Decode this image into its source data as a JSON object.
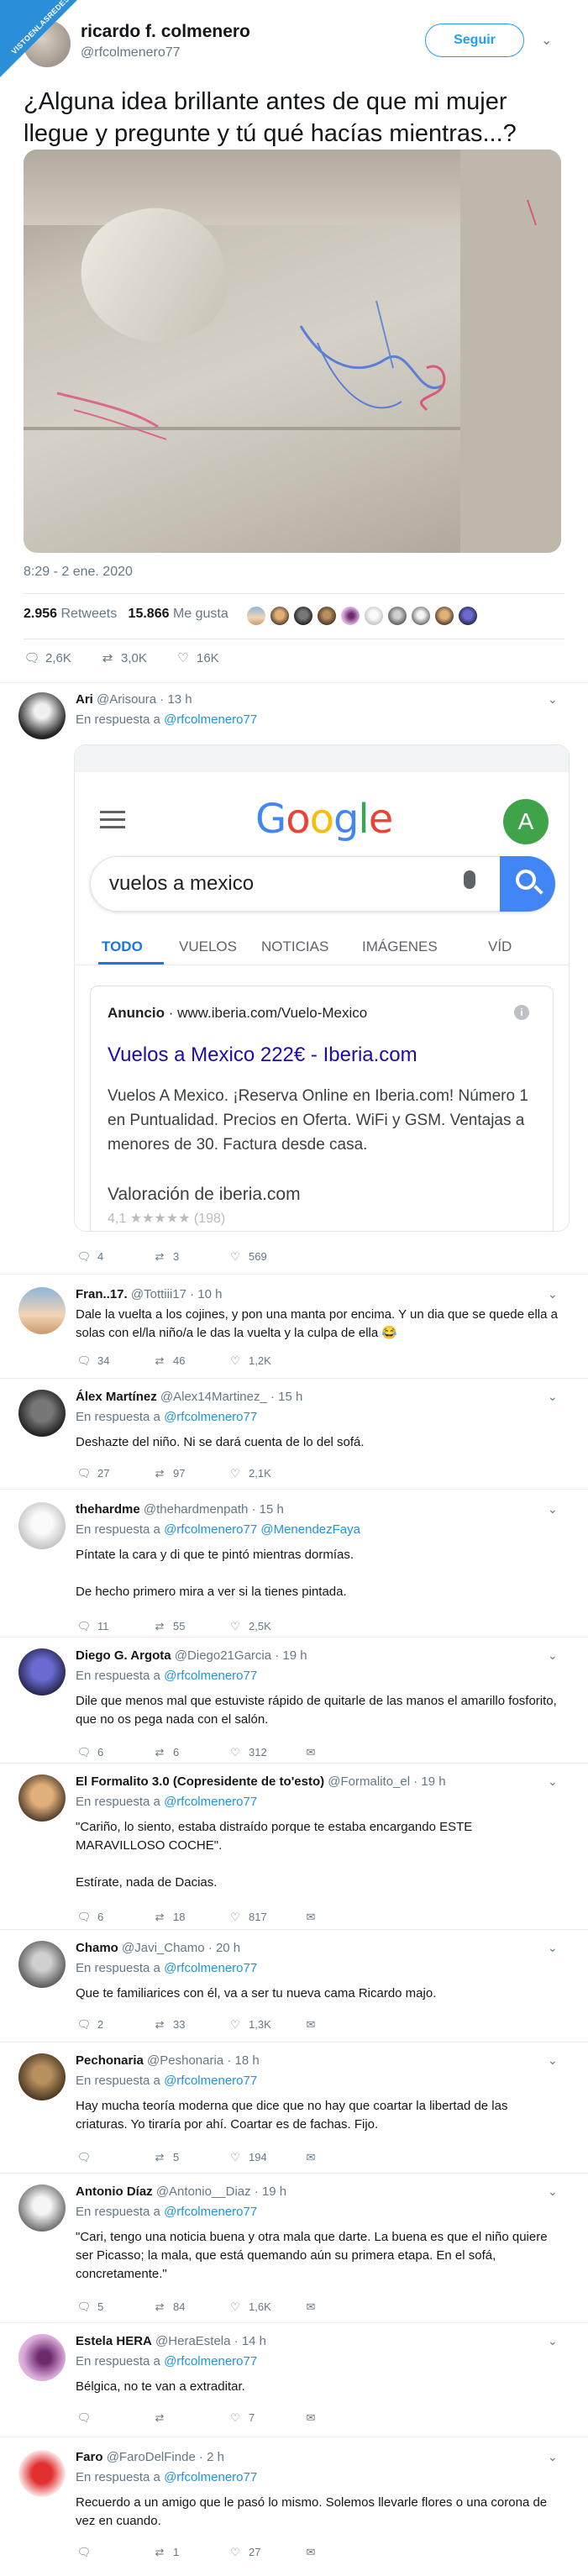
{
  "badge": "VISTOENLASREDES",
  "main_tweet": {
    "name": "ricardo f. colmenero",
    "handle": "@rfcolmenero77",
    "follow_label": "Seguir",
    "text": "¿Alguna idea brillante antes de que mi mujer llegue y pregunte y tú qué hacías mientras...?",
    "date": "8:29 - 2 ene. 2020",
    "retweets_count": "2.956",
    "retweets_label": "Retweets",
    "likes_count": "15.866",
    "likes_label": "Me gusta",
    "replies": "2,6K",
    "retweets_short": "3,0K",
    "likes_short": "16K"
  },
  "google_card": {
    "logo": "Google",
    "avatar_letter": "A",
    "query": "vuelos a mexico",
    "tabs": [
      "TODO",
      "VUELOS",
      "NOTICIAS",
      "IMÁGENES",
      "VÍD"
    ],
    "ad_label": "Anuncio",
    "ad_url": "www.iberia.com/Vuelo-Mexico",
    "ad_title": "Vuelos a Mexico 222€ - Iberia.com",
    "ad_desc": "Vuelos A Mexico. ¡Reserva Online en Iberia.com! Número 1 en Puntualidad. Precios en Oferta. WiFi y GSM. Ventajas a menores de 30. Factura desde casa.",
    "ad_rating": "Valoración de iberia.com",
    "ad_stars": "4,1 ★★★★★ (198)"
  },
  "replies": [
    {
      "name": "Ari",
      "handle": "@Arisoura",
      "time": "· 13 h",
      "resp_prefix": "En respuesta a",
      "resp_to": "@rfcolmenero77",
      "text": "",
      "r": "4",
      "rt": "3",
      "l": "569"
    },
    {
      "name": "Fran..17.",
      "handle": "@Tottiii17",
      "time": "· 10 h",
      "resp_prefix": "",
      "resp_to": "",
      "text": "Dale la vuelta a los cojines, y pon una manta por encima. Y un dia que se quede ella a solas con el/la niño/a le das la vuelta y la culpa de ella 😂",
      "r": "34",
      "rt": "46",
      "l": "1,2K"
    },
    {
      "name": "Álex Martínez",
      "handle": "@Alex14Martinez_",
      "time": "· 15 h",
      "resp_prefix": "En respuesta a",
      "resp_to": "@rfcolmenero77",
      "text": "Deshazte del niño. Ni se dará cuenta de lo del sofá.",
      "r": "27",
      "rt": "97",
      "l": "2,1K"
    },
    {
      "name": "thehardme",
      "handle": "@thehardmenpath",
      "time": "· 15 h",
      "resp_prefix": "En respuesta a",
      "resp_to": "@rfcolmenero77 @MenendezFaya",
      "text": "Píntate la cara y di que te pintó mientras dormías.\n\nDe hecho primero mira a ver si la tienes pintada.",
      "r": "11",
      "rt": "55",
      "l": "2,5K"
    },
    {
      "name": "Diego G. Argota",
      "handle": "@Diego21Garcia",
      "time": "· 19 h",
      "resp_prefix": "En respuesta a",
      "resp_to": "@rfcolmenero77",
      "text": "Dile que menos mal que estuviste rápido de quitarle de las manos el amarillo fosforito, que no os pega nada con el salón.",
      "r": "6",
      "rt": "6",
      "l": "312"
    },
    {
      "name": "El Formalito 3.0 (Copresidente de to'esto)",
      "handle": "@Formalito_el",
      "time": "· 19 h",
      "resp_prefix": "En respuesta a",
      "resp_to": "@rfcolmenero77",
      "text": "\"Cariño, lo siento, estaba distraído porque te estaba encargando ESTE MARAVILLOSO COCHE\".\n\nEstírate, nada de Dacias.",
      "r": "6",
      "rt": "18",
      "l": "817"
    },
    {
      "name": "Chamo",
      "handle": "@Javi_Chamo",
      "time": "· 20 h",
      "resp_prefix": "En respuesta a",
      "resp_to": "@rfcolmenero77",
      "text": "Que te familiarices con él, va a ser tu nueva cama Ricardo majo.",
      "r": "2",
      "rt": "33",
      "l": "1,3K"
    },
    {
      "name": "Pechonaria",
      "handle": "@Peshonaria",
      "time": "· 18 h",
      "resp_prefix": "En respuesta a",
      "resp_to": "@rfcolmenero77",
      "text": "Hay mucha teoría moderna que dice que no hay que coartar la libertad de las criaturas. Yo tiraría por ahí. Coartar es de fachas. Fijo.",
      "r": "",
      "rt": "5",
      "l": "194"
    },
    {
      "name": "Antonio Díaz",
      "handle": "@Antonio__Diaz",
      "time": "· 19 h",
      "resp_prefix": "En respuesta a",
      "resp_to": "@rfcolmenero77",
      "text": "\"Cari, tengo una noticia buena y otra mala que darte. La buena es que el niño quiere ser Picasso; la mala, que está quemando aún su primera etapa. En el sofá, concretamente.\"",
      "r": "5",
      "rt": "84",
      "l": "1,6K"
    },
    {
      "name": "Estela HERA",
      "handle": "@HeraEstela",
      "time": "· 14 h",
      "resp_prefix": "En respuesta a",
      "resp_to": "@rfcolmenero77",
      "text": "Bélgica, no te van a extraditar.",
      "r": "",
      "rt": "",
      "l": "7"
    },
    {
      "name": "Faro",
      "handle": "@FaroDelFinde",
      "time": "· 2 h",
      "resp_prefix": "En respuesta a",
      "resp_to": "@rfcolmenero77",
      "text": "Recuerdo a un amigo que le pasó lo mismo. Solemos llevarle flores o una corona de vez en cuando.",
      "r": "",
      "rt": "1",
      "l": "27"
    }
  ],
  "icons": {
    "reply": "reply-icon",
    "retweet": "retweet-icon",
    "like": "heart-icon",
    "message": "envelope-icon",
    "chevron": "chevron-down-icon"
  }
}
